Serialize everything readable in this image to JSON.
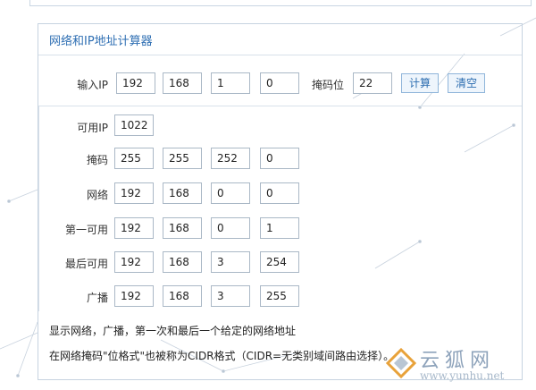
{
  "calculator": {
    "title": "网络和IP地址计算器",
    "input_label": "输入IP",
    "ip": [
      "192",
      "168",
      "1",
      "0"
    ],
    "mask_bits_label": "掩码位",
    "mask_bits": "22",
    "calc_button": "计算",
    "clear_button": "清空"
  },
  "results": {
    "available_label": "可用IP",
    "available_value": "1022",
    "rows": [
      {
        "label": "掩码",
        "values": [
          "255",
          "255",
          "252",
          "0"
        ]
      },
      {
        "label": "网络",
        "values": [
          "192",
          "168",
          "0",
          "0"
        ]
      },
      {
        "label": "第一可用",
        "values": [
          "192",
          "168",
          "0",
          "1"
        ]
      },
      {
        "label": "最后可用",
        "values": [
          "192",
          "168",
          "3",
          "254"
        ]
      },
      {
        "label": "广播",
        "values": [
          "192",
          "168",
          "3",
          "255"
        ]
      }
    ]
  },
  "notes": {
    "line1": "显示网络，广播，第一次和最后一个给定的网络地址",
    "line2": "在网络掩码\"位格式\"也被称为CIDR格式（CIDR=无类别域间路由选择）。"
  },
  "watermark": {
    "brand": "云狐网",
    "url": "www.yunhu.net",
    "accent": "#e8a23a"
  }
}
